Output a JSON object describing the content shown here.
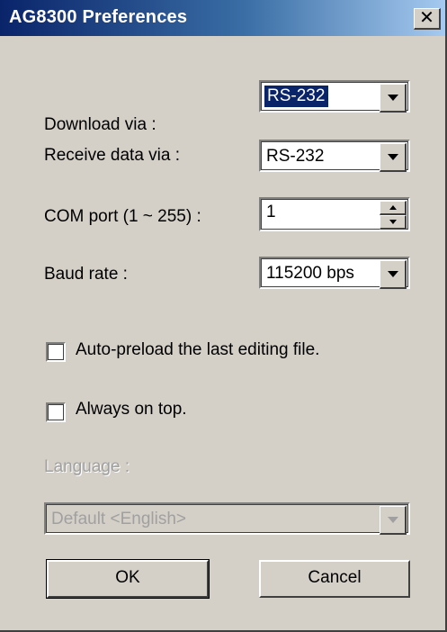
{
  "window": {
    "title": "AG8300 Preferences",
    "close_glyph": "✕"
  },
  "download": {
    "label": "Download via :",
    "value": "RS-232"
  },
  "receive": {
    "label": "Receive data via :",
    "value": "RS-232"
  },
  "com_port": {
    "label": "COM port (1 ~ 255) :",
    "value": "1"
  },
  "baud": {
    "label": "Baud rate :",
    "value": "115200 bps"
  },
  "options": {
    "autopreload_label": "Auto-preload the last editing file.",
    "autopreload_checked": false,
    "always_on_top_label": "Always on top.",
    "always_on_top_checked": false
  },
  "language": {
    "label": "Language :",
    "value": "Default <English>",
    "enabled": false
  },
  "buttons": {
    "ok": "OK",
    "cancel": "Cancel"
  },
  "colors": {
    "title_active": "#0a246a",
    "dialog_bg": "#d4d0c8",
    "selection": "#0a246a"
  }
}
